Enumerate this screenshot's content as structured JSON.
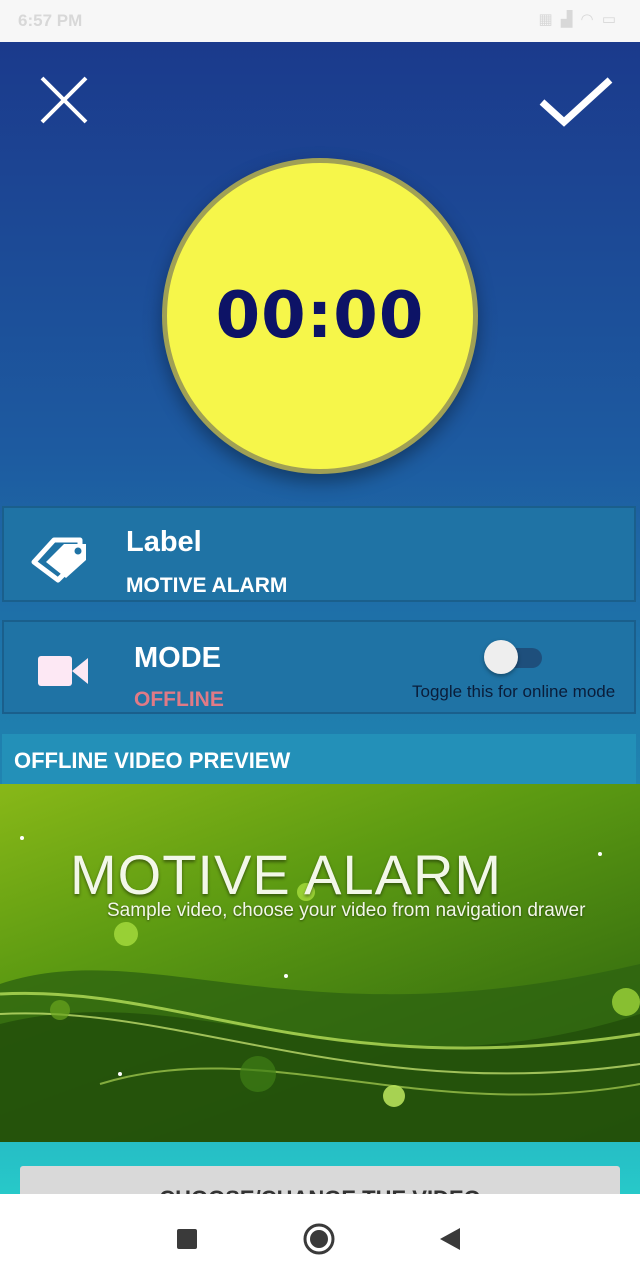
{
  "status_bar": {
    "time": "6:57 PM",
    "icons": [
      "calendar-icon",
      "signal-icon",
      "wifi-icon",
      "battery-icon"
    ]
  },
  "toolbar": {
    "close_icon": "close-icon",
    "confirm_icon": "check-icon"
  },
  "timer": {
    "display": "00:00"
  },
  "label_card": {
    "title": "Label",
    "value": "MOTIVE ALARM",
    "icon": "tag-icon"
  },
  "mode_card": {
    "title": "MODE",
    "value": "OFFLINE",
    "icon": "video-camera-icon",
    "toggle_on": false,
    "toggle_hint": "Toggle this for online mode"
  },
  "preview": {
    "header": "OFFLINE VIDEO PREVIEW",
    "video_title": "MOTIVE ALARM",
    "video_subtitle": "Sample video, choose your video from navigation drawer"
  },
  "choose_button": {
    "label": "CHOOSE/CHANGE THE VIDEO"
  },
  "nav_bar": {
    "buttons": [
      "recents-icon",
      "home-icon",
      "back-icon"
    ]
  },
  "colors": {
    "timer_fill": "#f6f64a",
    "timer_text": "#0d1366",
    "offline_text": "#e07a86",
    "card_bg": "#1f73a5"
  }
}
